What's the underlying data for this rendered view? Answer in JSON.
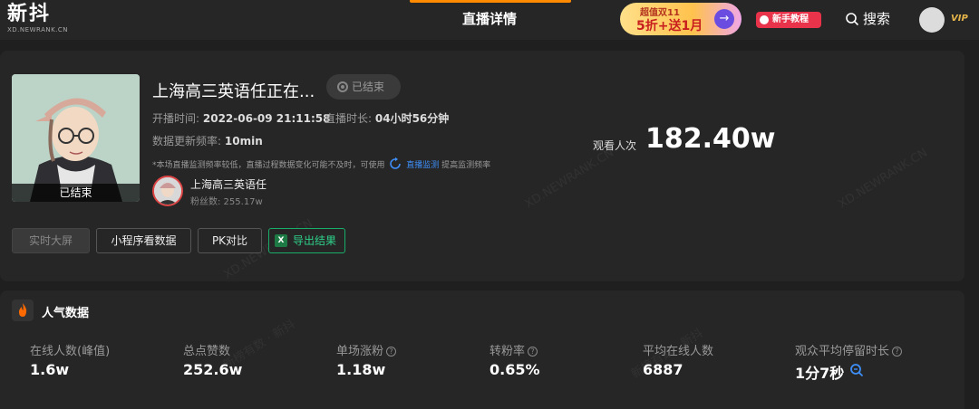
{
  "header": {
    "logo": "新抖",
    "logo_sub": "XD.NEWRANK.CN",
    "page_title": "直播详情",
    "promo_top": "超值双11",
    "promo_main": "5折+送1月",
    "newbie_label": "新手教程",
    "search_label": "搜索",
    "vip_label": "VIP"
  },
  "live": {
    "cover_badge": "已结束",
    "title": "上海高三英语任正在...",
    "status": "已结束",
    "start_label": "开播时间:",
    "start_value": "2022-06-09 21:11:58",
    "duration_label": "直播时长:",
    "duration_value": "04小时56分钟",
    "update_label": "数据更新频率:",
    "update_value": "10min",
    "notice_text": "*本场直播监测频率较低，直播过程数据变化可能不及时，可使用",
    "notice_link": "直播监测",
    "notice_tail": "提高监测频率",
    "anchor_name": "上海高三英语任",
    "anchor_fans": "粉丝数: 255.17w",
    "viewers_label": "观看人次",
    "viewers_value": "182.40w"
  },
  "actions": {
    "realtime": "实时大屏",
    "mini_program": "小程序看数据",
    "pk": "PK对比",
    "export": "导出结果"
  },
  "watermarks": [
    "XD.NEWRANK.CN",
    "XD.NEWRANK.CN",
    "XD.NEWRANK.CN",
    "新榜有数 · 新抖",
    "新榜有数 · 新抖"
  ],
  "popularity": {
    "title": "人气数据",
    "stats": [
      {
        "label": "在线人数(峰值)",
        "value": "1.6w"
      },
      {
        "label": "总点赞数",
        "value": "252.6w"
      },
      {
        "label": "单场涨粉",
        "value": "1.18w"
      },
      {
        "label": "转粉率",
        "value": "0.65%"
      },
      {
        "label": "平均在线人数",
        "value": "6887"
      },
      {
        "label": "观众平均停留时长",
        "value": "1分7秒"
      }
    ]
  },
  "colors": {
    "background": "#1f1f1f",
    "card": "#262626",
    "accent_orange": "#ff8a00",
    "link_blue": "#3e8ef7",
    "export_green": "#1aad6a",
    "newbie_red": "#e8334a"
  }
}
